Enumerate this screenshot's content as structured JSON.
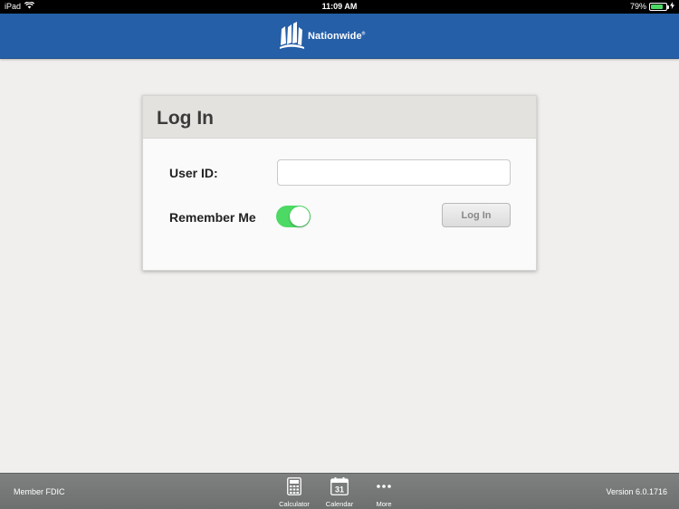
{
  "status_bar": {
    "device": "iPad",
    "time": "11:09 AM",
    "battery_percent": "79%",
    "battery_level": 0.79
  },
  "header": {
    "brand": "Nationwide",
    "brand_mark": "®"
  },
  "login": {
    "title": "Log In",
    "user_id_label": "User ID:",
    "user_id_value": "",
    "remember_label": "Remember Me",
    "remember_on": true,
    "submit_label": "Log In"
  },
  "footer": {
    "left_text": "Member FDIC",
    "version": "Version 6.0.1716",
    "tabs": [
      {
        "label": "Calculator",
        "icon": "calculator-icon"
      },
      {
        "label": "Calendar",
        "icon": "calendar-icon",
        "badge": "31"
      },
      {
        "label": "More",
        "icon": "more-icon"
      }
    ]
  },
  "colors": {
    "header": "#255fa8",
    "toggle_on": "#4cd964",
    "tab_bar": "#76787a"
  }
}
